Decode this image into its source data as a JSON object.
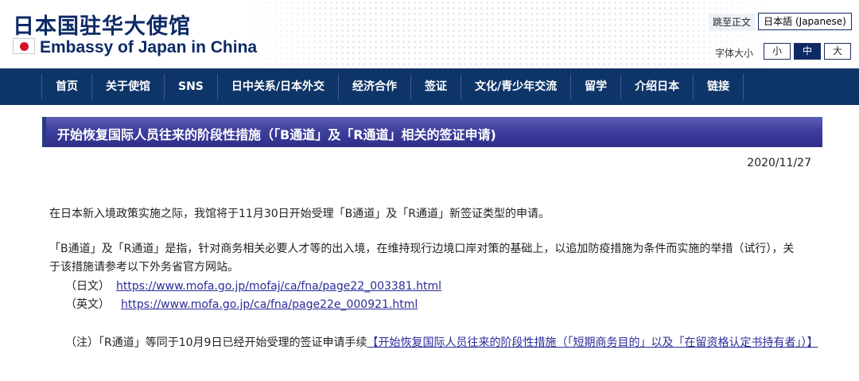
{
  "header": {
    "title_cn": "日本国驻华大使馆",
    "title_en": "Embassy of Japan in China",
    "skip_link": "跳至正文",
    "language_button": "日本語 (Japanese)",
    "font_size_label": "字体大小",
    "font_sizes": [
      "小",
      "中",
      "大"
    ],
    "font_size_selected": "中"
  },
  "nav": {
    "items": [
      "首页",
      "关于使馆",
      "SNS",
      "日中关系/日本外交",
      "经济合作",
      "签证",
      "文化/青少年交流",
      "留学",
      "介绍日本",
      "链接"
    ]
  },
  "article": {
    "title": "开始恢复国际人员往来的阶段性措施（「B通道」及「R通道」相关的签证申请)",
    "date": "2020/11/27",
    "p1": "在日本新入境政策实施之际，我馆将于11月30日开始受理「B通道」及「R通道」新签证类型的申请。",
    "p2": "「B通道」及「R通道」是指，针对商务相关必要人才等的出入境，在维持现行边境口岸对策的基础上，以追加防疫措施为条件而实施的举措（试行），关于该措施请参考以下外务省官方网站。",
    "refs": [
      {
        "label": "（日文）",
        "url": "https://www.mofa.go.jp/mofaj/ca/fna/page22_003381.html"
      },
      {
        "label": "（英文）",
        "url": "https://www.mofa.go.jp/ca/fna/page22e_000921.html"
      }
    ],
    "note_text": "（注）「R通道」等同于10月9日已经开始受理的签证申请手续",
    "note_link": "【开始恢复国际人员往来的阶段性措施（「短期商务目的」以及「在留资格认定书持有者」）】"
  },
  "colors": {
    "brand_navy": "#0e3567",
    "title_text": "#0d2a66",
    "title_bar": "#3f3f9f",
    "link": "#2b2b9a",
    "flag_red": "#d2142a"
  }
}
